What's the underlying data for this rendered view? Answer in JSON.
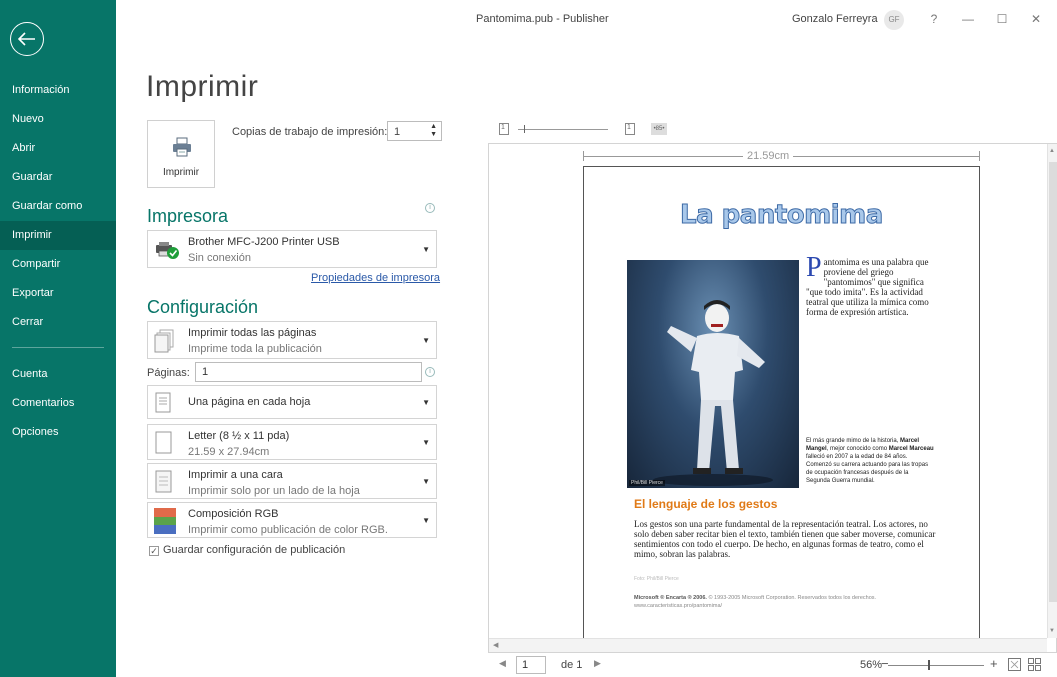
{
  "window": {
    "title": "Pantomima.pub - Publisher",
    "user_name": "Gonzalo Ferreyra",
    "user_initials": "GF",
    "help": "?",
    "minimize": "—",
    "maximize": "☐",
    "close": "✕"
  },
  "sidebar": {
    "items": [
      {
        "label": "Información"
      },
      {
        "label": "Nuevo"
      },
      {
        "label": "Abrir"
      },
      {
        "label": "Guardar"
      },
      {
        "label": "Guardar como"
      },
      {
        "label": "Imprimir"
      },
      {
        "label": "Compartir"
      },
      {
        "label": "Exportar"
      },
      {
        "label": "Cerrar"
      }
    ],
    "bottom_items": [
      {
        "label": "Cuenta"
      },
      {
        "label": "Comentarios"
      },
      {
        "label": "Opciones"
      }
    ]
  },
  "print": {
    "title": "Imprimir",
    "button_label": "Imprimir",
    "copies_label": "Copias de trabajo de impresión:",
    "copies_value": "1"
  },
  "printer": {
    "section_title": "Impresora",
    "name": "Brother MFC-J200 Printer USB",
    "status": "Sin conexión",
    "properties_link": "Propiedades de impresora"
  },
  "settings": {
    "section_title": "Configuración",
    "pages_dropdown": {
      "title": "Imprimir todas las páginas",
      "subtitle": "Imprime toda la publicación"
    },
    "pages_label": "Páginas:",
    "pages_value": "1",
    "layout_dropdown": {
      "title": "Una página en cada hoja"
    },
    "paper_dropdown": {
      "title": "Letter (8 ½ x 11 pda)",
      "subtitle": "21.59 x 27.94cm"
    },
    "sides_dropdown": {
      "title": "Imprimir a una cara",
      "subtitle": "Imprimir solo por un lado de la hoja"
    },
    "color_dropdown": {
      "title": "Composición RGB",
      "subtitle": "Imprimir como publicación de color RGB."
    },
    "save_settings_label": "Guardar configuración de publicación",
    "save_settings_checked": true
  },
  "preview": {
    "toolbar_page_a": "1",
    "toolbar_page_b": "1",
    "toolbar_spread": "•85•",
    "ruler_label": "21.59cm",
    "page_number": "1",
    "of_label": "de 1",
    "zoom_label": "56%",
    "zoom_fraction": 0.42
  },
  "publication": {
    "title": "La pantomima",
    "intro_drop": "P",
    "intro_text": "antomima es una palabra que proviene del griego \"pantomimos\" que significa \"que todo imita\". Es la actividad teatral que utiliza la mímica como forma de expresión artística.",
    "photo_credit": "Phil/Bill Pierce",
    "caption_1": "El más grande mimo de la historia, ",
    "caption_bold_1": "Marcel Mangel",
    "caption_2": ", mejor conocido como ",
    "caption_bold_2": "Marcel Marceau",
    "caption_3": " falleció en 2007 a la edad de 84 años. Comenzó su carrera actuando para las tropas de ocupación francesas después de la Segunda Guerra mundial.",
    "subheading": "El lenguaje de los gestos",
    "body": "Los gestos son una parte fundamental de la representación teatral. Los actores, no solo deben saber recitar bien el texto, también tienen que saber moverse, comunicar sentimientos con todo el cuerpo. De hecho, en algunas formas de teatro, como el mimo, sobran las palabras.",
    "credit_line": "Foto: Phil/Bill Pierce",
    "footer_bold": "Microsoft ® Encarta ® 2006.",
    "footer_text": " © 1993-2005 Microsoft Corporation. Reservados todos los derechos.",
    "footer_url": "www.caracteristicas.pro/pantomima/"
  },
  "colors": {
    "sidebar": "#077568",
    "accent": "#077568",
    "pub_title": "#a9c8ea",
    "subheading": "#e07a17"
  }
}
